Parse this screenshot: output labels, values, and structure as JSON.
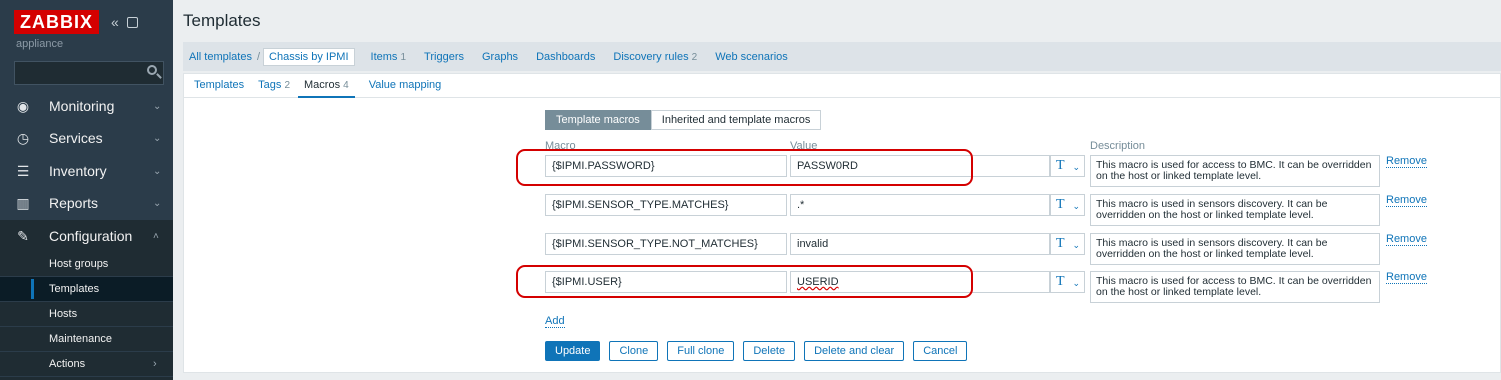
{
  "sidebar": {
    "logo": "ZABBIX",
    "collapse_icon": "«",
    "subtitle": "appliance",
    "nav": [
      {
        "label": "Monitoring",
        "icon": "eye-icon",
        "glyph": "👁"
      },
      {
        "label": "Services",
        "icon": "clock-icon",
        "glyph": "◷"
      },
      {
        "label": "Inventory",
        "icon": "list-icon",
        "glyph": "≡"
      },
      {
        "label": "Reports",
        "icon": "bar-chart-icon",
        "glyph": "▥"
      },
      {
        "label": "Configuration",
        "icon": "wrench-icon",
        "glyph": "🔧"
      }
    ],
    "submenu": [
      "Host groups",
      "Templates",
      "Hosts",
      "Maintenance",
      "Actions"
    ]
  },
  "header": {
    "title": "Templates"
  },
  "breadcrumb": {
    "all_templates": "All templates",
    "separator": "/",
    "current": "Chassis by IPMI",
    "items": [
      {
        "label": "Items",
        "count": "1"
      },
      {
        "label": "Triggers",
        "count": ""
      },
      {
        "label": "Graphs",
        "count": ""
      },
      {
        "label": "Dashboards",
        "count": ""
      },
      {
        "label": "Discovery rules",
        "count": "2"
      },
      {
        "label": "Web scenarios",
        "count": ""
      }
    ]
  },
  "tabs": [
    {
      "label": "Templates",
      "count": ""
    },
    {
      "label": "Tags",
      "count": "2"
    },
    {
      "label": "Macros",
      "count": "4"
    },
    {
      "label": "Value mapping",
      "count": ""
    }
  ],
  "macro_tabs": [
    "Template macros",
    "Inherited and template macros"
  ],
  "columns": {
    "macro": "Macro",
    "value": "Value",
    "description": "Description"
  },
  "macros": [
    {
      "macro": "{$IPMI.PASSWORD}",
      "value": "PASSW0RD",
      "type": "T",
      "description": "This macro is used for access to BMC. It can be overridden on the host or linked template level.",
      "remove": "Remove"
    },
    {
      "macro": "{$IPMI.SENSOR_TYPE.MATCHES}",
      "value": ".*",
      "type": "T",
      "description": "This macro is used in sensors discovery. It can be overridden on the host or linked template level.",
      "remove": "Remove"
    },
    {
      "macro": "{$IPMI.SENSOR_TYPE.NOT_MATCHES}",
      "value": "invalid",
      "type": "T",
      "description": "This macro is used in sensors discovery. It can be overridden on the host or linked template level.",
      "remove": "Remove"
    },
    {
      "macro": "{$IPMI.USER}",
      "value": "USERID",
      "type": "T",
      "description": "This macro is used for access to BMC. It can be overridden on the host or linked template level.",
      "remove": "Remove"
    }
  ],
  "add_label": "Add",
  "buttons": {
    "update": "Update",
    "clone": "Clone",
    "full_clone": "Full clone",
    "delete": "Delete",
    "delete_clear": "Delete and clear",
    "cancel": "Cancel"
  },
  "colors": {
    "brand": "#d40000",
    "sidebar": "#2b3c4a",
    "link": "#0f74b8",
    "highlight": "#d40000"
  }
}
